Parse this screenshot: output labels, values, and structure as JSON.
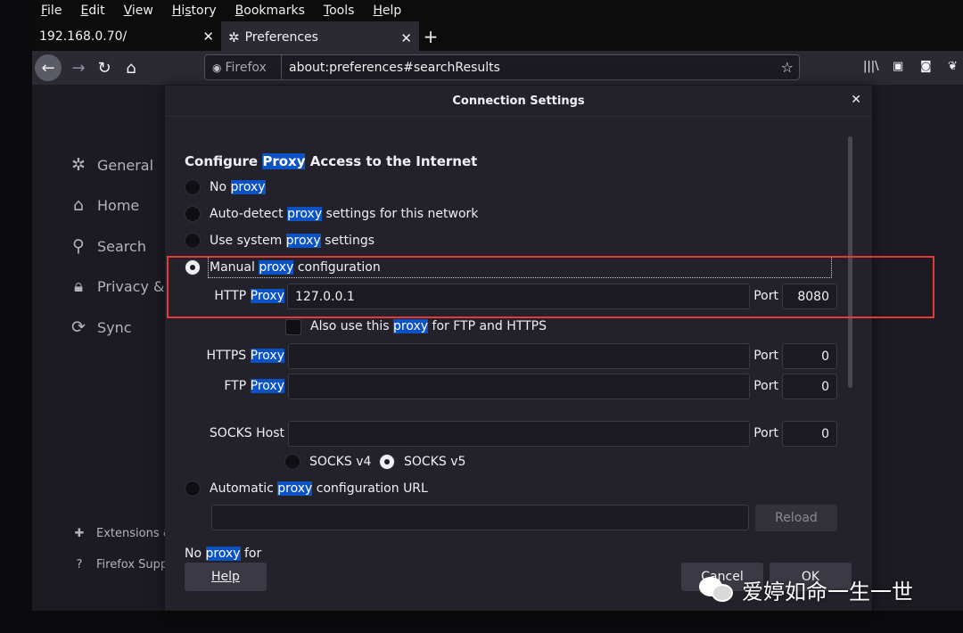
{
  "menu": [
    "File",
    "Edit",
    "View",
    "History",
    "Bookmarks",
    "Tools",
    "Help"
  ],
  "tabs": [
    {
      "title": "192.168.0.70/",
      "close": "✕"
    },
    {
      "title": "Preferences",
      "close": "✕"
    }
  ],
  "newtab": "+",
  "urlbar": {
    "identity": "Firefox",
    "url": "about:preferences#searchResults"
  },
  "sidebar": {
    "general": "General",
    "home": "Home",
    "search": "Search",
    "privacy": "Privacy & S",
    "sync": "Sync",
    "extensions": "Extensions &",
    "support": "Firefox Supp"
  },
  "dialog": {
    "title": "Connection Settings",
    "close": "✕",
    "heading_pre": "Configure ",
    "heading_hl": "Proxy",
    "heading_post": " Access to the Internet",
    "options": {
      "no_proxy": {
        "pre": "No ",
        "hl": "proxy",
        "post": "",
        "selected": false
      },
      "auto_detect": {
        "pre": "Auto-detect ",
        "hl": "proxy",
        "post": " settings for this network",
        "selected": false
      },
      "system": {
        "pre": "Use system ",
        "hl": "proxy",
        "post": " settings",
        "selected": false
      },
      "manual": {
        "pre": "Manual ",
        "hl": "proxy",
        "post": " configuration",
        "selected": true
      },
      "auto_url": {
        "pre": "Automatic ",
        "hl": "proxy",
        "post": " configuration URL",
        "selected": false
      }
    },
    "http": {
      "label_pre": "HTTP ",
      "label_hl": "Proxy",
      "value": "127.0.0.1",
      "port_label": "Port",
      "port": "8080"
    },
    "also_use": {
      "pre": "Also use this ",
      "hl": "proxy",
      "post": " for FTP and HTTPS"
    },
    "https": {
      "label_pre": "HTTPS ",
      "label_hl": "Proxy",
      "value": "",
      "port_label": "Port",
      "port": "0"
    },
    "ftp": {
      "label_pre": "FTP ",
      "label_hl": "Proxy",
      "value": "",
      "port_label": "Port",
      "port": "0"
    },
    "socks": {
      "label": "SOCKS Host",
      "value": "",
      "port_label": "Port",
      "port": "0",
      "v4": "SOCKS v4",
      "v5": "SOCKS v5",
      "v5_selected": true
    },
    "pac_url": "",
    "reload": "Reload",
    "no_proxy_for_pre": "No ",
    "no_proxy_for_hl": "proxy",
    "no_proxy_for_post": " for",
    "help": "Help",
    "cancel": "Cancel",
    "ok": "OK"
  },
  "watermark": "爱婷如命一生一世",
  "colors": {
    "highlight": "#0b53c4",
    "annotation_box": "#e03a3a"
  }
}
